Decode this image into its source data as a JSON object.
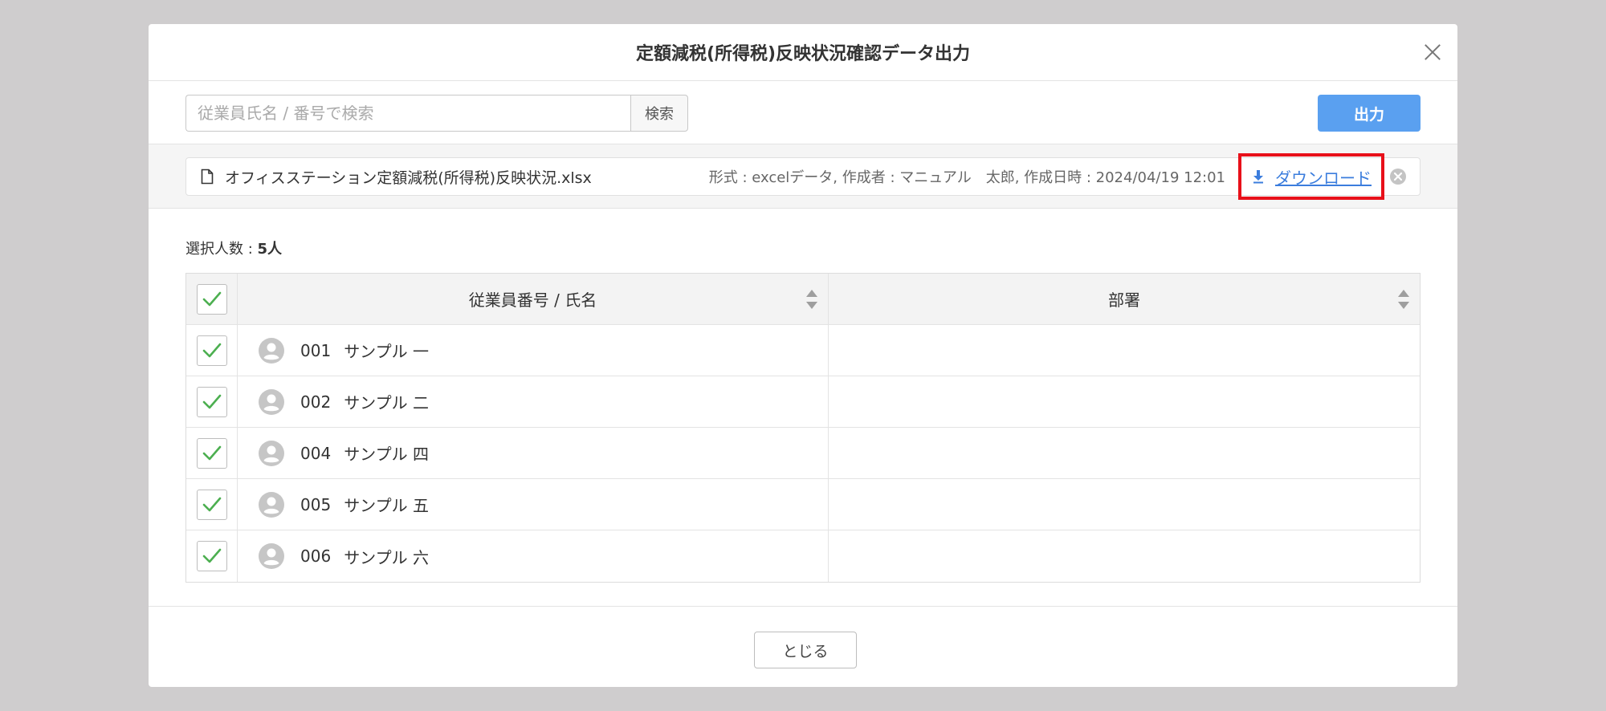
{
  "modal": {
    "title": "定額減税(所得税)反映状況確認データ出力"
  },
  "toolbar": {
    "search_placeholder": "従業員氏名 / 番号で検索",
    "search_button": "検索",
    "output_button": "出力"
  },
  "file": {
    "name": "オフィスステーション定額減税(所得税)反映状況.xlsx",
    "meta": "形式 : excelデータ, 作成者 : マニュアル　太郎, 作成日時 : 2024/04/19 12:01",
    "download_label": "ダウンロード"
  },
  "selection": {
    "label": "選択人数 : ",
    "count": "5人"
  },
  "table": {
    "headers": {
      "employee": "従業員番号 / 氏名",
      "department": "部署"
    },
    "rows": [
      {
        "no": "001",
        "name": "サンプル 一",
        "department": "",
        "checked": true
      },
      {
        "no": "002",
        "name": "サンプル 二",
        "department": "",
        "checked": true
      },
      {
        "no": "004",
        "name": "サンプル 四",
        "department": "",
        "checked": true
      },
      {
        "no": "005",
        "name": "サンプル 五",
        "department": "",
        "checked": true
      },
      {
        "no": "006",
        "name": "サンプル 六",
        "department": "",
        "checked": true
      }
    ]
  },
  "footer": {
    "close_button": "とじる"
  },
  "colors": {
    "primary": "#5aa0f0",
    "check": "#4caf50",
    "highlight": "#e8101a",
    "link": "#3b7ddd"
  }
}
